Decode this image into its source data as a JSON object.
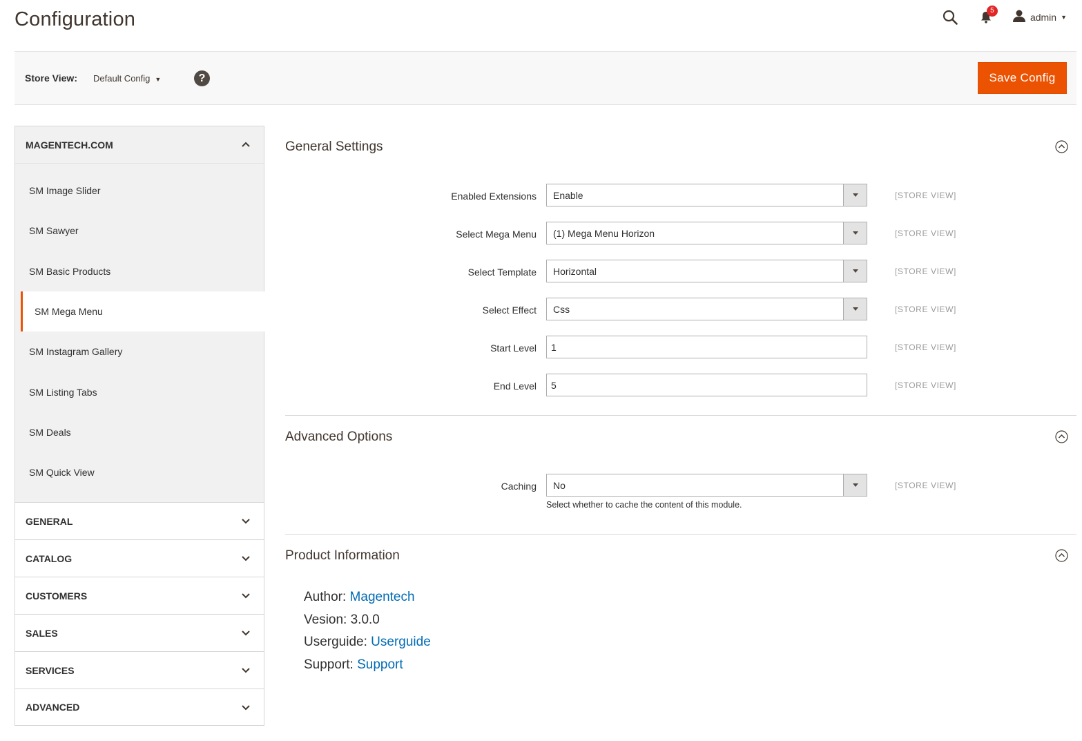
{
  "header": {
    "title": "Configuration",
    "notification_count": "5",
    "user_name": "admin"
  },
  "store_bar": {
    "label": "Store View:",
    "scope_value": "Default Config",
    "help_symbol": "?",
    "save_label": "Save Config"
  },
  "sidebar": {
    "open_tab": {
      "label": "MAGENTECH.COM",
      "items": [
        {
          "label": "SM Image Slider"
        },
        {
          "label": "SM Sawyer"
        },
        {
          "label": "SM Basic Products"
        },
        {
          "label": "SM Mega Menu",
          "active": true
        },
        {
          "label": "SM Instagram Gallery"
        },
        {
          "label": "SM Listing Tabs"
        },
        {
          "label": "SM Deals"
        },
        {
          "label": "SM Quick View"
        }
      ]
    },
    "closed_tabs": [
      {
        "label": "GENERAL"
      },
      {
        "label": "CATALOG"
      },
      {
        "label": "CUSTOMERS"
      },
      {
        "label": "SALES"
      },
      {
        "label": "SERVICES"
      },
      {
        "label": "ADVANCED"
      }
    ]
  },
  "sections": {
    "general": {
      "title": "General Settings",
      "fields": [
        {
          "label": "Enabled Extensions",
          "type": "select",
          "value": "Enable",
          "scope": "[STORE VIEW]"
        },
        {
          "label": "Select Mega Menu",
          "type": "select",
          "value": "(1) Mega Menu Horizon",
          "scope": "[STORE VIEW]"
        },
        {
          "label": "Select Template",
          "type": "select",
          "value": "Horizontal",
          "scope": "[STORE VIEW]"
        },
        {
          "label": "Select Effect",
          "type": "select",
          "value": "Css",
          "scope": "[STORE VIEW]"
        },
        {
          "label": "Start Level",
          "type": "text",
          "value": "1",
          "scope": "[STORE VIEW]"
        },
        {
          "label": "End Level",
          "type": "text",
          "value": "5",
          "scope": "[STORE VIEW]"
        }
      ]
    },
    "advanced": {
      "title": "Advanced Options",
      "caching": {
        "label": "Caching",
        "value": "No",
        "scope": "[STORE VIEW]",
        "note": "Select whether to cache the content of this module."
      }
    },
    "product_info": {
      "title": "Product Information",
      "author_label": "Author:",
      "author_link": "Magentech",
      "version_text": "Vesion: 3.0.0",
      "userguide_label": "Userguide:",
      "userguide_link": "Userguide",
      "support_label": "Support:",
      "support_link": "Support"
    }
  },
  "colors": {
    "accent": "#eb5202",
    "link": "#006bb4",
    "badge": "#e22626"
  }
}
